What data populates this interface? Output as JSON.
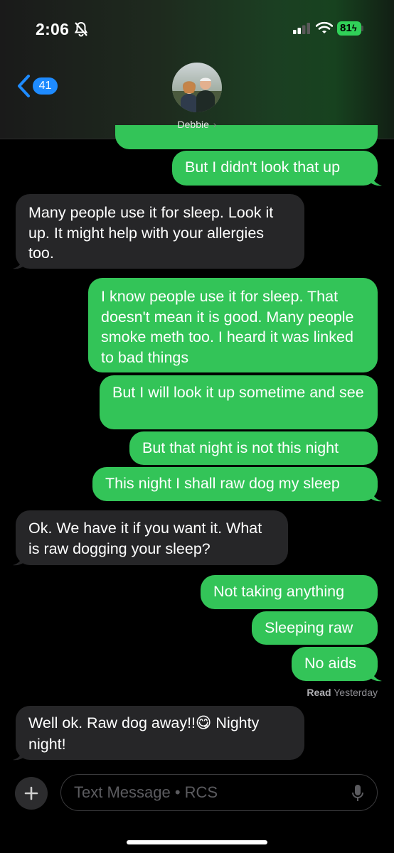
{
  "status_bar": {
    "time": "2:06",
    "battery": "81",
    "icons": [
      "bell-slash-icon",
      "cellular-signal-icon",
      "wifi-icon",
      "battery-icon"
    ]
  },
  "header": {
    "back_count": "41",
    "contact_name": "Debbie",
    "chevron": "›"
  },
  "messages": [
    {
      "direction": "out",
      "text": "But I didn't look that up"
    },
    {
      "direction": "in",
      "text": "Many people use it for sleep. Look it up. It might help with your allergies too."
    },
    {
      "direction": "out",
      "text": "I know people use it for sleep. That doesn't mean it is good. Many people smoke meth too.  I heard it was linked to bad things"
    },
    {
      "direction": "out",
      "text": "But I will look it up sometime and see"
    },
    {
      "direction": "out",
      "text": "But that night is not this night"
    },
    {
      "direction": "out",
      "text": "This night I shall raw dog my sleep"
    },
    {
      "direction": "in",
      "text": "Ok. We have it if you want it. What is raw dogging your sleep?"
    },
    {
      "direction": "out",
      "text": "Not taking anything"
    },
    {
      "direction": "out",
      "text": "Sleeping raw"
    },
    {
      "direction": "out",
      "text": "No aids"
    },
    {
      "direction": "in",
      "text_before": "Well ok. Raw dog away!!",
      "emoji": "😋",
      "text_after": " Nighty night!"
    }
  ],
  "read_receipt": {
    "label": "Read",
    "when": "Yesterday"
  },
  "composer": {
    "placeholder": "Text Message • RCS"
  },
  "colors": {
    "outgoing": "#33c458",
    "incoming": "#262628",
    "accent": "#1e8bff"
  }
}
